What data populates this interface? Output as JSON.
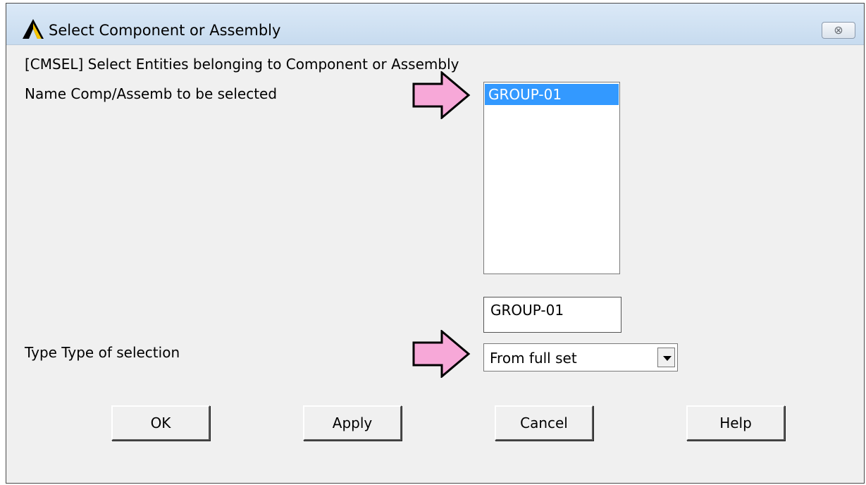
{
  "window": {
    "title": "Select Component or Assembly",
    "close_label": "⊗"
  },
  "form": {
    "command_label": "[CMSEL]  Select Entities belonging to Component or Assembly",
    "name_label": "Name  Comp/Assemb to be selected",
    "type_label": "Type  Type of selection"
  },
  "name_list": {
    "items": [
      "GROUP-01"
    ],
    "selected": "GROUP-01"
  },
  "name_input": {
    "value": "GROUP-01"
  },
  "type_select": {
    "value": "From full set"
  },
  "buttons": {
    "ok": "OK",
    "apply": "Apply",
    "cancel": "Cancel",
    "help": "Help"
  },
  "colors": {
    "selection": "#3399ff",
    "annotation_arrow": "#f7a8d8"
  }
}
